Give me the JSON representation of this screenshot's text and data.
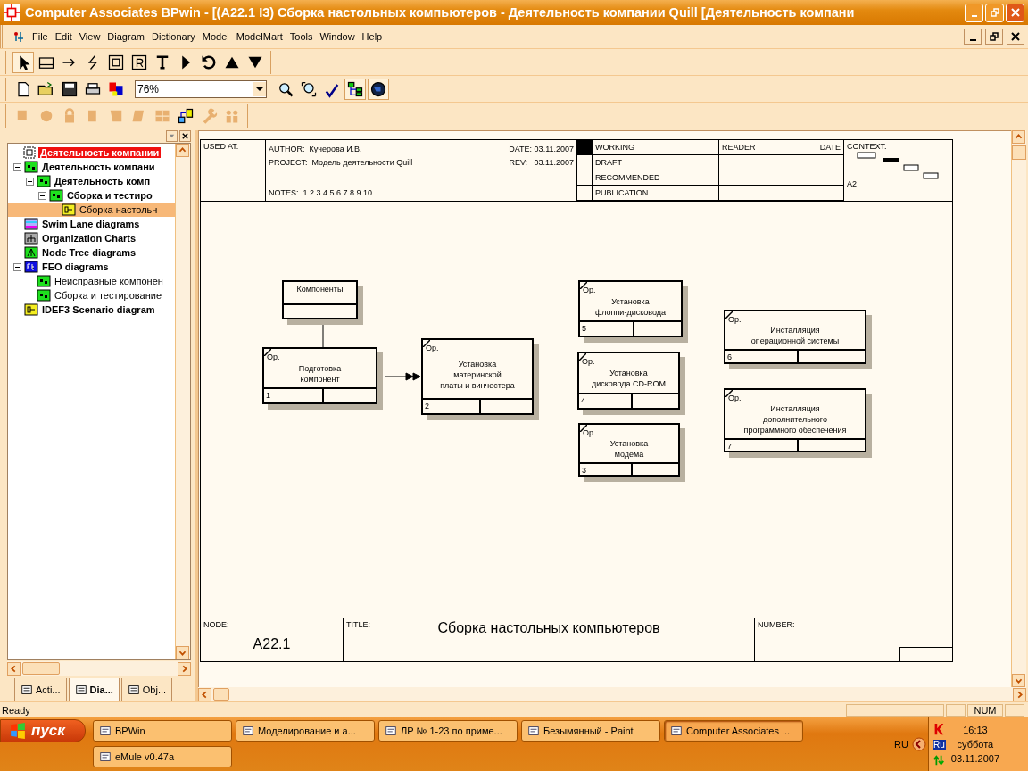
{
  "window": {
    "title": "Computer Associates BPwin - [(A22.1 I3) Сборка настольных компьютеров - Деятельность компании Quill  [Деятельность компани"
  },
  "menu": [
    "File",
    "Edit",
    "View",
    "Diagram",
    "Dictionary",
    "Model",
    "ModelMart",
    "Tools",
    "Window",
    "Help"
  ],
  "zoom": {
    "value": "76%"
  },
  "tree": [
    {
      "kind": "root",
      "label": "Деятельность компании",
      "bold": true,
      "selected": false,
      "children": [
        {
          "kind": "idef0",
          "label": "Деятельность компани",
          "bold": true,
          "selected": false,
          "expanded": true,
          "children": [
            {
              "kind": "idef0",
              "label": "Деятельность комп",
              "bold": true,
              "selected": false,
              "expanded": true,
              "children": [
                {
                  "kind": "idef0",
                  "label": "Сборка и тестиро",
                  "bold": true,
                  "selected": false,
                  "expanded": true,
                  "children": [
                    {
                      "kind": "idef3",
                      "label": "Сборка настольн",
                      "bold": false,
                      "selected": true
                    }
                  ]
                }
              ]
            }
          ]
        },
        {
          "kind": "swimlane",
          "label": "Swim Lane diagrams",
          "bold": true,
          "selected": false
        },
        {
          "kind": "orgchart",
          "label": "Organization Charts",
          "bold": true,
          "selected": false
        },
        {
          "kind": "nodetree",
          "label": "Node Tree diagrams",
          "bold": true,
          "selected": false
        },
        {
          "kind": "feo",
          "label": "FEO diagrams",
          "bold": true,
          "selected": false,
          "expanded": true,
          "children": [
            {
              "kind": "idef0",
              "label": "Неисправные компонен",
              "bold": false,
              "selected": false
            },
            {
              "kind": "idef0",
              "label": "Сборка и тестирование",
              "bold": false,
              "selected": false
            }
          ]
        },
        {
          "kind": "idef3",
          "label": "IDEF3 Scenario diagram",
          "bold": true,
          "selected": false
        }
      ]
    }
  ],
  "panel_tabs": [
    {
      "label": "Acti...",
      "selected": false
    },
    {
      "label": "Dia...",
      "selected": true
    },
    {
      "label": "Obj...",
      "selected": false
    }
  ],
  "header": {
    "used_at_label": "USED AT:",
    "author_label": "AUTHOR:",
    "author": "Кучерова И.В.",
    "date_label": "DATE:",
    "date": "03.11.2007",
    "project_label": "PROJECT:",
    "project": "Модель деятельности Quill",
    "rev_label": "REV:",
    "rev": "03.11.2007",
    "notes_label": "NOTES:",
    "notes": "1  2  3  4  5  6  7  8  9  10",
    "status": [
      {
        "label": "WORKING",
        "selected": true
      },
      {
        "label": "DRAFT",
        "selected": false
      },
      {
        "label": "RECOMMENDED",
        "selected": false
      },
      {
        "label": "PUBLICATION",
        "selected": false
      }
    ],
    "reader_label": "READER",
    "reader_date_label": "DATE",
    "context_label": "CONTEXT:",
    "context_node": "A2"
  },
  "boxes": [
    {
      "kind": "entity",
      "label": "Компоненты"
    },
    {
      "kind": "activity",
      "tag": "Ор.",
      "label": "Подготовка\nкомпонент",
      "number": "1"
    },
    {
      "kind": "activity",
      "tag": "Ор.",
      "label": "Установка\nматеринской\nплаты и винчестера",
      "number": "2"
    },
    {
      "kind": "activity",
      "tag": "Ор.",
      "label": "Установка\nфлоппи-дисковода",
      "number": "5"
    },
    {
      "kind": "activity",
      "tag": "Ор.",
      "label": "Установка\nдисковода CD-ROM",
      "number": "4"
    },
    {
      "kind": "activity",
      "tag": "Ор.",
      "label": "Установка\nмодема",
      "number": "3"
    },
    {
      "kind": "activity",
      "tag": "Ор.",
      "label": "Инсталляция\nоперационной системы",
      "number": "6"
    },
    {
      "kind": "activity",
      "tag": "Ор.",
      "label": "Инсталляция\nдополнительного\nпрограммного обеспечения",
      "number": "7"
    }
  ],
  "footer": {
    "node_label": "NODE:",
    "node": "A22.1",
    "title_label": "TITLE:",
    "title": "Сборка настольных компьютеров",
    "number_label": "NUMBER:"
  },
  "status_bar": {
    "text": "Ready",
    "num": "NUM"
  },
  "taskbar": {
    "start": "пуск",
    "tasks": [
      {
        "label": "BPWin",
        "selected": false
      },
      {
        "label": "Моделирование и а...",
        "selected": false
      },
      {
        "label": "ЛР № 1-23 по приме...",
        "selected": false
      },
      {
        "label": "Безымянный - Paint",
        "selected": false
      },
      {
        "label": "Computer Associates ...",
        "selected": true
      },
      {
        "label": "eMule v0.47a",
        "selected": false
      }
    ],
    "language": "RU",
    "tray_language": "Ru",
    "time": "16:13",
    "day": "суббота",
    "date": "03.11.2007"
  }
}
